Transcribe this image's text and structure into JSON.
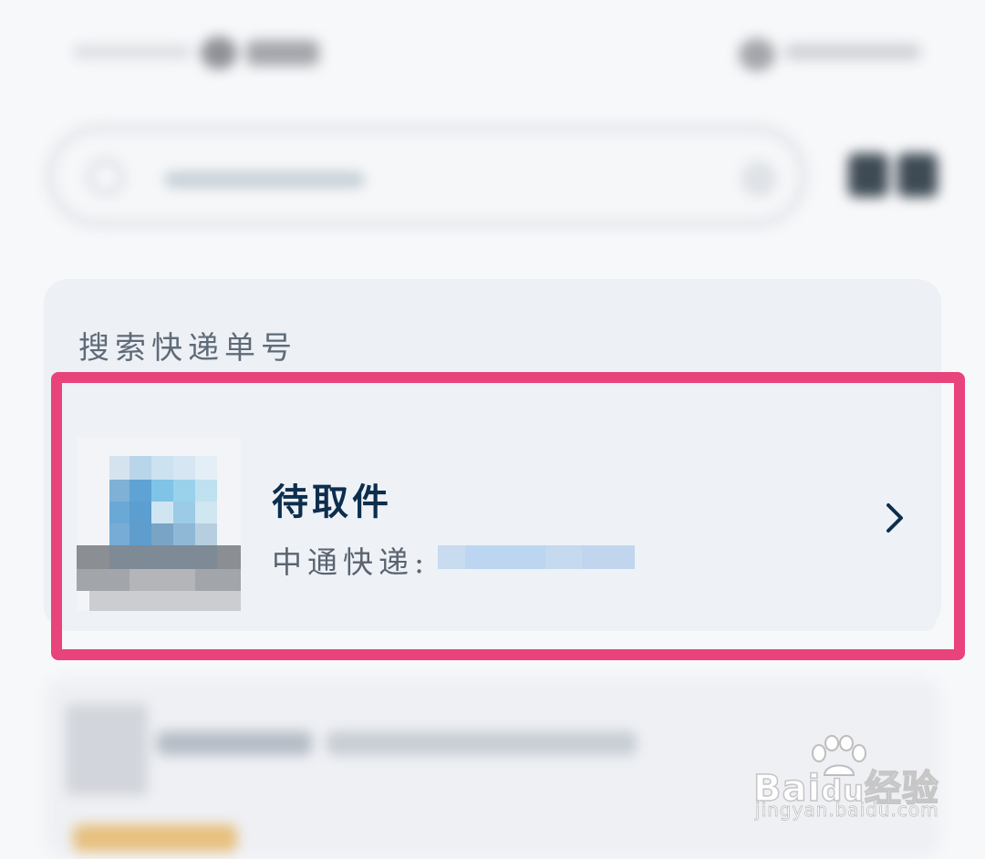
{
  "search_section": {
    "title": "搜索快递单号"
  },
  "result": {
    "status": "待取件",
    "courier_label": "中通快递:",
    "tracking_number_visible": false
  },
  "watermark": {
    "brand_latin": "Bai",
    "brand_paw": "du",
    "brand_cn": "经验",
    "url": "jingyan.baidu.com"
  },
  "colors": {
    "highlight": "#e8437a",
    "status_text": "#0d2e4d",
    "card_bg": "#edf0f5"
  },
  "icons": {
    "chevron": "chevron-right-icon",
    "search": "search-icon"
  }
}
